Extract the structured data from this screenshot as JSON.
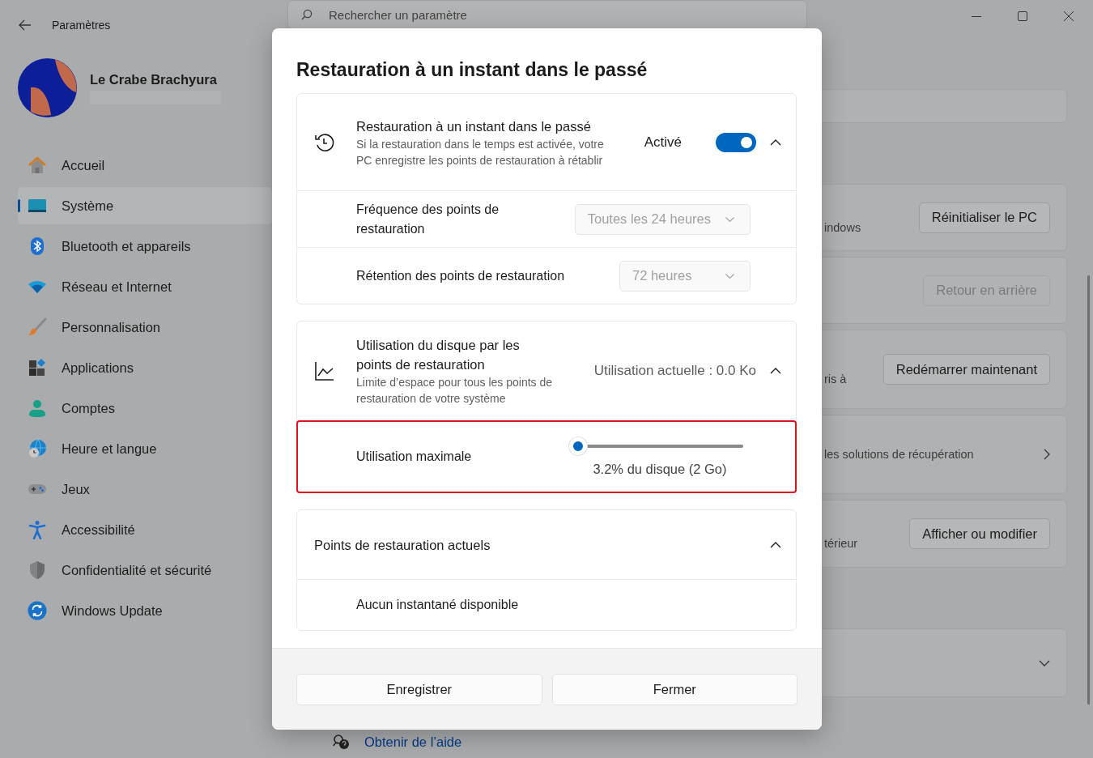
{
  "window": {
    "title": "Paramètres"
  },
  "search": {
    "placeholder": "Rechercher un paramètre"
  },
  "profile": {
    "name": "Le Crabe Brachyura"
  },
  "sidebar": {
    "items": [
      {
        "label": "Accueil",
        "selected": false
      },
      {
        "label": "Système",
        "selected": true
      },
      {
        "label": "Bluetooth et appareils",
        "selected": false
      },
      {
        "label": "Réseau et Internet",
        "selected": false
      },
      {
        "label": "Personnalisation",
        "selected": false
      },
      {
        "label": "Applications",
        "selected": false
      },
      {
        "label": "Comptes",
        "selected": false
      },
      {
        "label": "Heure et langue",
        "selected": false
      },
      {
        "label": "Jeux",
        "selected": false
      },
      {
        "label": "Accessibilité",
        "selected": false
      },
      {
        "label": "Confidentialité et sécurité",
        "selected": false
      },
      {
        "label": "Windows Update",
        "selected": false
      }
    ]
  },
  "background_cards": [
    {
      "kind": "button",
      "text": "indows",
      "button": "Réinitialiser le PC",
      "disabled": false
    },
    {
      "kind": "button",
      "button": "Retour en arrière",
      "disabled": true
    },
    {
      "kind": "button",
      "text": "ris à",
      "button": "Redémarrer maintenant",
      "disabled": false
    },
    {
      "kind": "link",
      "text": "les solutions de récupération"
    },
    {
      "kind": "button",
      "text": "térieur",
      "button": "Afficher ou modifier",
      "disabled": false
    },
    {
      "kind": "expander",
      "expanded": false
    }
  ],
  "help_link": "Obtenir de l’aide",
  "dialog": {
    "title": "Restauration à un instant dans le passé",
    "sections": [
      {
        "kind": "toggle",
        "title": "Restauration à un instant dans le passé",
        "description": "Si la restauration dans le temps est activée, votre PC enregistre les points de restauration à rétablir",
        "state_label": "Activé",
        "on": true,
        "expanded": true,
        "rows": [
          {
            "kind": "dropdown",
            "label": "Fréquence des points de restauration",
            "value": "Toutes les 24 heures",
            "disabled": true
          },
          {
            "kind": "dropdown",
            "label": "Rétention des points de restauration",
            "value": "72 heures",
            "disabled": true
          }
        ]
      },
      {
        "kind": "usage",
        "title": "Utilisation du disque par les points de restauration",
        "description": "Limite d’espace pour tous les points de restauration de votre système",
        "reading": "Utilisation actuelle : 0.0 Ko",
        "expanded": true,
        "rows": [
          {
            "kind": "slider",
            "label": "Utilisation maximale",
            "level": 0,
            "reading": "3.2% du disque (2 Go)",
            "highlighted": true
          }
        ]
      },
      {
        "kind": "plain",
        "title": "Points de restauration actuels",
        "expanded": true,
        "rows": [
          {
            "kind": "text",
            "label": "Aucun instantané disponible"
          }
        ]
      }
    ],
    "buttons": [
      "Enregistrer",
      "Fermer"
    ]
  }
}
